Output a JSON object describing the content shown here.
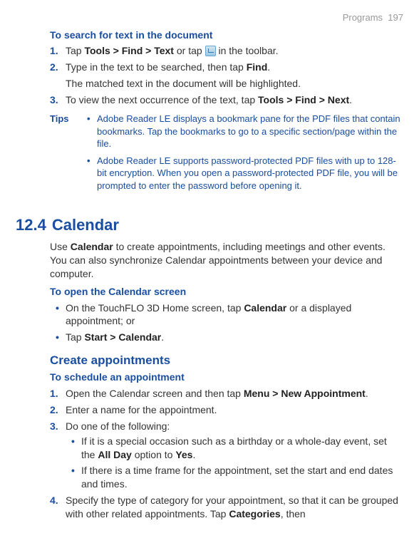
{
  "page_header": {
    "section": "Programs",
    "page_number": "197"
  },
  "search": {
    "heading": "To search for text in the document",
    "steps": [
      {
        "marker": "1.",
        "pre": "Tap ",
        "bold1": "Tools > Find > Text",
        "mid": " or tap ",
        "post": " in the toolbar."
      },
      {
        "marker": "2.",
        "text_a": "Type in the text to be searched, then tap ",
        "bold": "Find",
        "text_b": ".",
        "extra": "The matched text in the document will be highlighted."
      },
      {
        "marker": "3.",
        "text_a": "To view the next occurrence of the text, tap ",
        "bold": "Tools > Find > Next",
        "text_b": "."
      }
    ]
  },
  "tips": {
    "label": "Tips",
    "items": [
      "Adobe Reader LE displays a bookmark pane for the PDF files that contain bookmarks. Tap the bookmarks to go to a specific section/page within the file.",
      "Adobe Reader LE supports password-protected PDF files with up to 128-bit encryption. When you open a password-protected PDF file, you will be prompted to enter the password before opening it."
    ]
  },
  "calendar": {
    "section_number": "12.4",
    "section_title": "Calendar",
    "intro_a": "Use ",
    "intro_bold": "Calendar",
    "intro_b": " to create appointments, including meetings and other events. You can also synchronize Calendar appointments between your device and computer.",
    "open_heading": "To open the Calendar screen",
    "open_items": [
      {
        "pre": "On the TouchFLO 3D Home screen, tap ",
        "bold": "Calendar",
        "post": " or a displayed appointment; or"
      },
      {
        "pre": "Tap ",
        "bold": "Start > Calendar",
        "post": "."
      }
    ],
    "create_heading": "Create appointments",
    "schedule_heading": "To schedule an appointment",
    "schedule_steps": [
      {
        "marker": "1.",
        "pre": "Open the Calendar screen and then tap ",
        "bold": "Menu > New Appointment",
        "post": "."
      },
      {
        "marker": "2.",
        "text": "Enter a name for the appointment."
      },
      {
        "marker": "3.",
        "text": "Do one of the following:",
        "subitems": [
          {
            "pre": "If it is a special occasion such as a birthday or a whole-day event, set the ",
            "bold1": "All Day",
            "mid": " option to ",
            "bold2": "Yes",
            "post": "."
          },
          {
            "text": "If there is a time frame for the appointment, set the start and end dates and times."
          }
        ]
      },
      {
        "marker": "4.",
        "pre": "Specify the type of category for your appointment, so that it can be grouped with other related appointments. Tap ",
        "bold": "Categories",
        "post": ", then"
      }
    ]
  }
}
